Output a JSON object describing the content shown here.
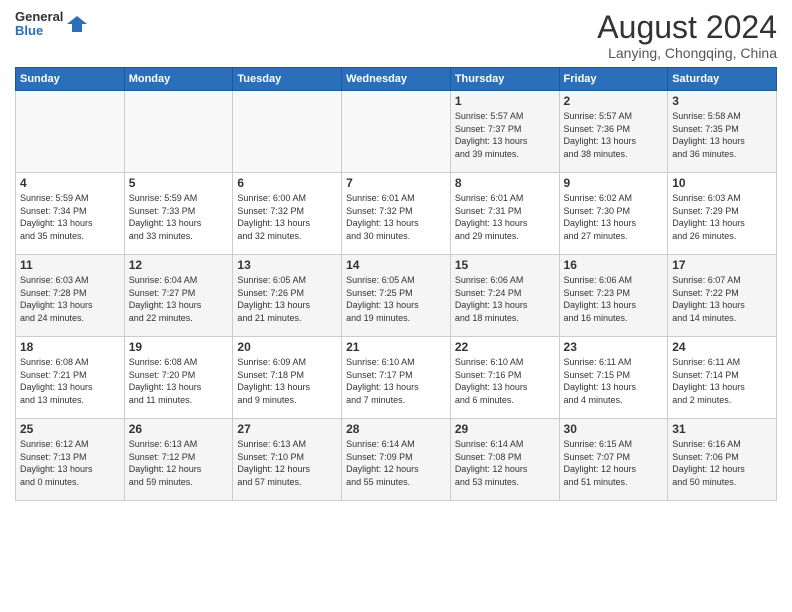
{
  "header": {
    "logo_line1": "General",
    "logo_line2": "Blue",
    "month": "August 2024",
    "location": "Lanying, Chongqing, China"
  },
  "weekdays": [
    "Sunday",
    "Monday",
    "Tuesday",
    "Wednesday",
    "Thursday",
    "Friday",
    "Saturday"
  ],
  "weeks": [
    [
      {
        "day": "",
        "info": ""
      },
      {
        "day": "",
        "info": ""
      },
      {
        "day": "",
        "info": ""
      },
      {
        "day": "",
        "info": ""
      },
      {
        "day": "1",
        "info": "Sunrise: 5:57 AM\nSunset: 7:37 PM\nDaylight: 13 hours\nand 39 minutes."
      },
      {
        "day": "2",
        "info": "Sunrise: 5:57 AM\nSunset: 7:36 PM\nDaylight: 13 hours\nand 38 minutes."
      },
      {
        "day": "3",
        "info": "Sunrise: 5:58 AM\nSunset: 7:35 PM\nDaylight: 13 hours\nand 36 minutes."
      }
    ],
    [
      {
        "day": "4",
        "info": "Sunrise: 5:59 AM\nSunset: 7:34 PM\nDaylight: 13 hours\nand 35 minutes."
      },
      {
        "day": "5",
        "info": "Sunrise: 5:59 AM\nSunset: 7:33 PM\nDaylight: 13 hours\nand 33 minutes."
      },
      {
        "day": "6",
        "info": "Sunrise: 6:00 AM\nSunset: 7:32 PM\nDaylight: 13 hours\nand 32 minutes."
      },
      {
        "day": "7",
        "info": "Sunrise: 6:01 AM\nSunset: 7:32 PM\nDaylight: 13 hours\nand 30 minutes."
      },
      {
        "day": "8",
        "info": "Sunrise: 6:01 AM\nSunset: 7:31 PM\nDaylight: 13 hours\nand 29 minutes."
      },
      {
        "day": "9",
        "info": "Sunrise: 6:02 AM\nSunset: 7:30 PM\nDaylight: 13 hours\nand 27 minutes."
      },
      {
        "day": "10",
        "info": "Sunrise: 6:03 AM\nSunset: 7:29 PM\nDaylight: 13 hours\nand 26 minutes."
      }
    ],
    [
      {
        "day": "11",
        "info": "Sunrise: 6:03 AM\nSunset: 7:28 PM\nDaylight: 13 hours\nand 24 minutes."
      },
      {
        "day": "12",
        "info": "Sunrise: 6:04 AM\nSunset: 7:27 PM\nDaylight: 13 hours\nand 22 minutes."
      },
      {
        "day": "13",
        "info": "Sunrise: 6:05 AM\nSunset: 7:26 PM\nDaylight: 13 hours\nand 21 minutes."
      },
      {
        "day": "14",
        "info": "Sunrise: 6:05 AM\nSunset: 7:25 PM\nDaylight: 13 hours\nand 19 minutes."
      },
      {
        "day": "15",
        "info": "Sunrise: 6:06 AM\nSunset: 7:24 PM\nDaylight: 13 hours\nand 18 minutes."
      },
      {
        "day": "16",
        "info": "Sunrise: 6:06 AM\nSunset: 7:23 PM\nDaylight: 13 hours\nand 16 minutes."
      },
      {
        "day": "17",
        "info": "Sunrise: 6:07 AM\nSunset: 7:22 PM\nDaylight: 13 hours\nand 14 minutes."
      }
    ],
    [
      {
        "day": "18",
        "info": "Sunrise: 6:08 AM\nSunset: 7:21 PM\nDaylight: 13 hours\nand 13 minutes."
      },
      {
        "day": "19",
        "info": "Sunrise: 6:08 AM\nSunset: 7:20 PM\nDaylight: 13 hours\nand 11 minutes."
      },
      {
        "day": "20",
        "info": "Sunrise: 6:09 AM\nSunset: 7:18 PM\nDaylight: 13 hours\nand 9 minutes."
      },
      {
        "day": "21",
        "info": "Sunrise: 6:10 AM\nSunset: 7:17 PM\nDaylight: 13 hours\nand 7 minutes."
      },
      {
        "day": "22",
        "info": "Sunrise: 6:10 AM\nSunset: 7:16 PM\nDaylight: 13 hours\nand 6 minutes."
      },
      {
        "day": "23",
        "info": "Sunrise: 6:11 AM\nSunset: 7:15 PM\nDaylight: 13 hours\nand 4 minutes."
      },
      {
        "day": "24",
        "info": "Sunrise: 6:11 AM\nSunset: 7:14 PM\nDaylight: 13 hours\nand 2 minutes."
      }
    ],
    [
      {
        "day": "25",
        "info": "Sunrise: 6:12 AM\nSunset: 7:13 PM\nDaylight: 13 hours\nand 0 minutes."
      },
      {
        "day": "26",
        "info": "Sunrise: 6:13 AM\nSunset: 7:12 PM\nDaylight: 12 hours\nand 59 minutes."
      },
      {
        "day": "27",
        "info": "Sunrise: 6:13 AM\nSunset: 7:10 PM\nDaylight: 12 hours\nand 57 minutes."
      },
      {
        "day": "28",
        "info": "Sunrise: 6:14 AM\nSunset: 7:09 PM\nDaylight: 12 hours\nand 55 minutes."
      },
      {
        "day": "29",
        "info": "Sunrise: 6:14 AM\nSunset: 7:08 PM\nDaylight: 12 hours\nand 53 minutes."
      },
      {
        "day": "30",
        "info": "Sunrise: 6:15 AM\nSunset: 7:07 PM\nDaylight: 12 hours\nand 51 minutes."
      },
      {
        "day": "31",
        "info": "Sunrise: 6:16 AM\nSunset: 7:06 PM\nDaylight: 12 hours\nand 50 minutes."
      }
    ]
  ]
}
